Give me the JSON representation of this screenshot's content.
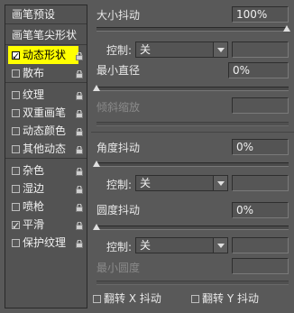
{
  "sidebar": {
    "preset_label": "画笔预设",
    "tip_shape_label": "画笔笔尖形状",
    "items": [
      {
        "label": "动态形状",
        "checked": true,
        "selected": true,
        "locked": true
      },
      {
        "label": "散布",
        "checked": false,
        "selected": false,
        "locked": true
      },
      {
        "label": "纹理",
        "checked": false,
        "selected": false,
        "locked": true
      },
      {
        "label": "双重画笔",
        "checked": false,
        "selected": false,
        "locked": true
      },
      {
        "label": "动态颜色",
        "checked": false,
        "selected": false,
        "locked": true
      },
      {
        "label": "其他动态",
        "checked": false,
        "selected": false,
        "locked": true
      },
      {
        "label": "杂色",
        "checked": false,
        "selected": false,
        "locked": true
      },
      {
        "label": "湿边",
        "checked": false,
        "selected": false,
        "locked": true
      },
      {
        "label": "喷枪",
        "checked": false,
        "selected": false,
        "locked": true
      },
      {
        "label": "平滑",
        "checked": true,
        "selected": false,
        "locked": true
      },
      {
        "label": "保护纹理",
        "checked": false,
        "selected": false,
        "locked": true
      }
    ]
  },
  "size_jitter": {
    "label": "大小抖动",
    "value": "100%",
    "level": 1.0
  },
  "size_control": {
    "label": "控制:",
    "value": "关"
  },
  "min_diameter": {
    "label": "最小直径",
    "value": "0%",
    "level": 0.0
  },
  "tilt_scale": {
    "label": "倾斜缩放",
    "value": ""
  },
  "angle_jitter": {
    "label": "角度抖动",
    "value": "0%",
    "level": 0.0
  },
  "angle_control": {
    "label": "控制:",
    "value": "关"
  },
  "roundness_jitter": {
    "label": "圆度抖动",
    "value": "0%",
    "level": 0.0
  },
  "roundness_control": {
    "label": "控制:",
    "value": "关"
  },
  "min_roundness": {
    "label": "最小圆度",
    "value": ""
  },
  "flip_x": {
    "label": "翻转 X 抖动",
    "checked": false
  },
  "flip_y": {
    "label": "翻转 Y 抖动",
    "checked": false
  },
  "colors": {
    "selected_bg": "#ffff00",
    "panel_bg": "#595959"
  }
}
